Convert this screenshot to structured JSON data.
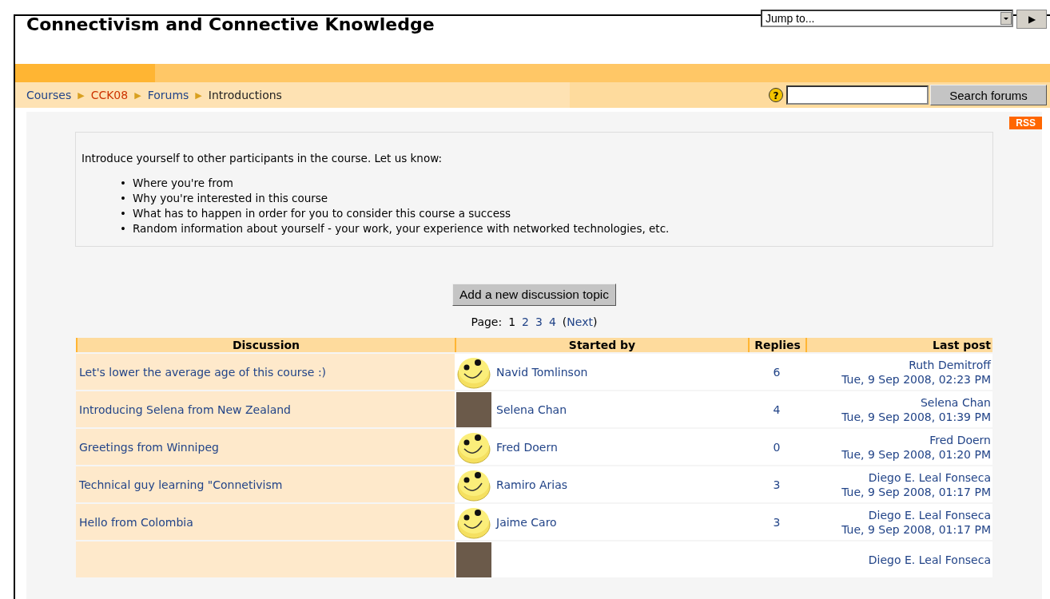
{
  "header": {
    "title": "Connectivism and Connective Knowledge",
    "jump_to": {
      "value": "Jump to...",
      "go": "▶"
    }
  },
  "breadcrumb": [
    {
      "label": "Courses",
      "kind": "link"
    },
    {
      "label": "CCK08",
      "kind": "visited"
    },
    {
      "label": "Forums",
      "kind": "link"
    },
    {
      "label": "Introductions",
      "kind": "current"
    }
  ],
  "breadcrumb_separator": "▶",
  "search": {
    "help": "?",
    "button": "Search forums"
  },
  "rss": "RSS",
  "intro": {
    "text": "Introduce yourself to other participants in the course. Let us know:",
    "bullet": "•",
    "items": [
      "Where you're from",
      "Why you're interested in this course",
      "What has to happen in order for you to consider this course a success",
      "Random information about yourself - your work, your experience with networked technologies, etc."
    ]
  },
  "add_button": "Add a new discussion topic",
  "pagination": {
    "label": "Page:",
    "pages": [
      {
        "label": "1",
        "selected": true
      },
      {
        "label": "2",
        "selected": false
      },
      {
        "label": "3",
        "selected": false
      },
      {
        "label": "4",
        "selected": false
      }
    ],
    "next_open": "(",
    "next": "Next",
    "next_close": ")"
  },
  "table": {
    "columns": [
      "Discussion",
      "Started by",
      "Replies",
      "Last post"
    ],
    "rows": [
      {
        "discussion": "Let's lower the average age of this course :)",
        "kind": "smiley",
        "started_by": "Navid Tomlinson",
        "replies": "6",
        "last_post_by": "Ruth Demitroff",
        "last_post_date": "Tue, 9 Sep 2008, 02:23 PM"
      },
      {
        "discussion": "Introducing Selena from New Zealand",
        "kind": "photo",
        "started_by": "Selena Chan",
        "replies": "4",
        "last_post_by": "Selena Chan",
        "last_post_date": "Tue, 9 Sep 2008, 01:39 PM"
      },
      {
        "discussion": "Greetings from Winnipeg",
        "kind": "smiley",
        "started_by": "Fred Doern",
        "replies": "0",
        "last_post_by": "Fred Doern",
        "last_post_date": "Tue, 9 Sep 2008, 01:20 PM"
      },
      {
        "discussion": "Technical guy learning \"Connetivism",
        "kind": "smiley",
        "started_by": "Ramiro Arias",
        "replies": "3",
        "last_post_by": "Diego E. Leal Fonseca",
        "last_post_date": "Tue, 9 Sep 2008, 01:17 PM"
      },
      {
        "discussion": "Hello from Colombia",
        "kind": "smiley",
        "started_by": "Jaime Caro",
        "replies": "3",
        "last_post_by": "Diego E. Leal Fonseca",
        "last_post_date": "Tue, 9 Sep 2008, 01:17 PM"
      },
      {
        "kind": "photo",
        "last_post_by": "Diego E. Leal Fonseca"
      }
    ]
  }
}
